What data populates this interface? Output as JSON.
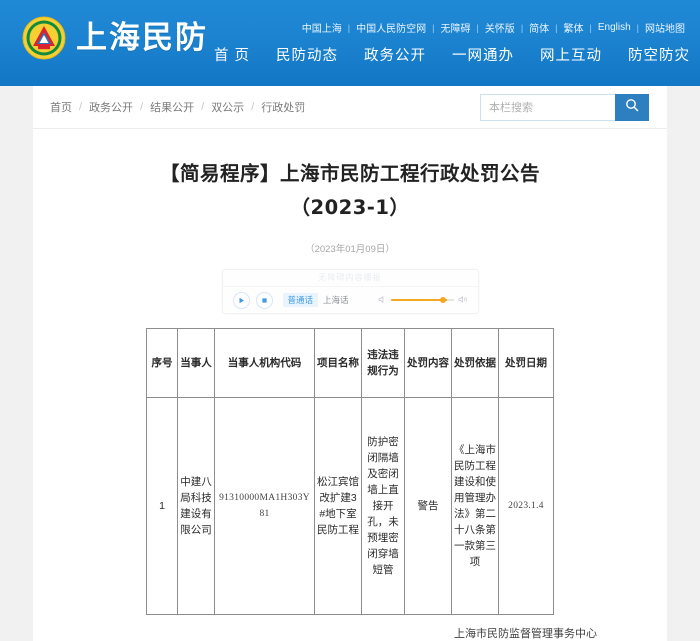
{
  "header": {
    "brand_name": "上海民防",
    "logo_icon": "civil-defense-emblem-icon",
    "top_links": [
      "中国上海",
      "中国人民防空网",
      "无障碍",
      "关怀版",
      "简体",
      "繁体",
      "English",
      "网站地图"
    ],
    "nav_items": [
      "首 页",
      "民防动态",
      "政务公开",
      "一网通办",
      "网上互动",
      "防空防灾"
    ],
    "background_color": "#1b82cf"
  },
  "breadcrumb": {
    "items": [
      "首页",
      "政务公开",
      "结果公开",
      "双公示",
      "行政处罚"
    ],
    "separator": "/"
  },
  "search": {
    "placeholder": "本栏搜索",
    "value": "",
    "button_icon": "search-icon",
    "button_color": "#2e7fc0"
  },
  "article": {
    "title_line1": "【简易程序】上海市民防工程行政处罚公告",
    "title_line2": "（2023-1）",
    "date": "（2023年01月09日）",
    "signature": "上海市民防监督管理事务中心"
  },
  "player": {
    "header_label": "无障碍内容播报",
    "play_icon": "play-icon",
    "stop_icon": "stop-icon",
    "languages": [
      "普通话",
      "上海话"
    ],
    "active_language": "普通话",
    "volume_low_icon": "volume-low-icon",
    "volume_high_icon": "volume-high-icon",
    "volume_color": "#f5a623"
  },
  "table": {
    "headers": [
      "序号",
      "当事人",
      "当事人机构代码",
      "项目名称",
      "违法违规行为",
      "处罚内容",
      "处罚依据",
      "处罚日期"
    ],
    "rows": [
      {
        "index": "1",
        "party": "中建八局科技建设有限公司",
        "code": "91310000MA1H303Y81",
        "project": "松江宾馆改扩建3#地下室民防工程",
        "violation": "防护密闭隔墙及密闭墙上直接开孔，未预埋密闭穿墙短管",
        "penalty": "警告",
        "basis": "《上海市民防工程建设和使用管理办法》第二十八条第一款第三项",
        "date": "2023.1.4"
      }
    ]
  }
}
